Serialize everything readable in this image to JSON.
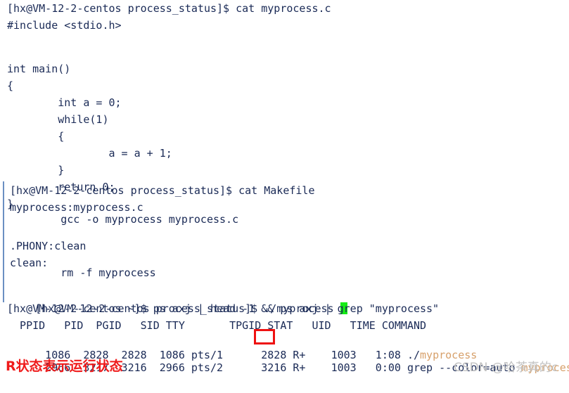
{
  "theme": {
    "background": "#ffffff",
    "text_color": "#1a2a56",
    "rule_color": "#6b8fc2",
    "cursor_color": "#15ec15",
    "grep_highlight_color": "#d7a06a",
    "annotation_color": "#ef1b1b",
    "watermark_color": "#c2c2c2"
  },
  "terminal": {
    "prompts": {
      "cat_source": "[hx@VM-12-2-centos process_status]$ cat myprocess.c",
      "cat_makefile": "[hx@VM-12-2-centos process_status]$ cat Makefile",
      "run_program": "[hx@VM-12-2-centos process_status]$ ./myprocess ",
      "ps_command": "[hx@VM-12-2-centos ~]$ ps axj | head -1 && ps axj | grep \"myprocess\""
    },
    "source_file": {
      "name": "myprocess.c",
      "lines": [
        "#include <stdio.h>",
        "",
        "",
        "int main()",
        "{",
        "        int a = 0;",
        "        while(1)",
        "        {",
        "                a = a + 1;",
        "        }",
        "        return 0;",
        "}"
      ]
    },
    "makefile": {
      "name": "Makefile",
      "lines": [
        "myprocess:myprocess.c",
        "        gcc -o myprocess myprocess.c",
        "",
        ".PHONY:clean",
        "clean:",
        "        rm -f myprocess"
      ]
    },
    "ps_output": {
      "headers": [
        "PPID",
        "PID",
        "PGID",
        "SID",
        "TTY",
        "TPGID",
        "STAT",
        "UID",
        "TIME",
        "COMMAND"
      ],
      "header_line": "  PPID   PID  PGID   SID TTY       TPGID STAT   UID   TIME COMMAND",
      "rows": [
        {
          "ppid": "1086",
          "pid": "2828",
          "pgid": "2828",
          "sid": "1086",
          "tty": "pts/1",
          "tpgid": "2828",
          "stat": "R+",
          "uid": "1003",
          "time": "1:08",
          "command_prefix": "./",
          "command_highlight": "myprocess",
          "command_suffix": "",
          "line_prefix": "  1086  2828  2828  1086 pts/1      2828 R+    1003   1:08 ",
          "highlighted": true
        },
        {
          "ppid": "2966",
          "pid": "3217",
          "pgid": "3216",
          "sid": "2966",
          "tty": "pts/2",
          "tpgid": "3216",
          "stat": "R+",
          "uid": "1003",
          "time": "0:00",
          "command_prefix": "grep --color=auto ",
          "command_highlight": "myprocess",
          "command_suffix": "",
          "line_prefix": "  2966  3217  3216  2966 pts/2      3216 R+    1003   0:00 ",
          "highlighted": false
        }
      ]
    }
  },
  "annotations": {
    "stat_highlight_value": "R+",
    "note_text": "R状态表示运行状态"
  },
  "watermark": {
    "text": "CSDN @哈茶真的c"
  }
}
